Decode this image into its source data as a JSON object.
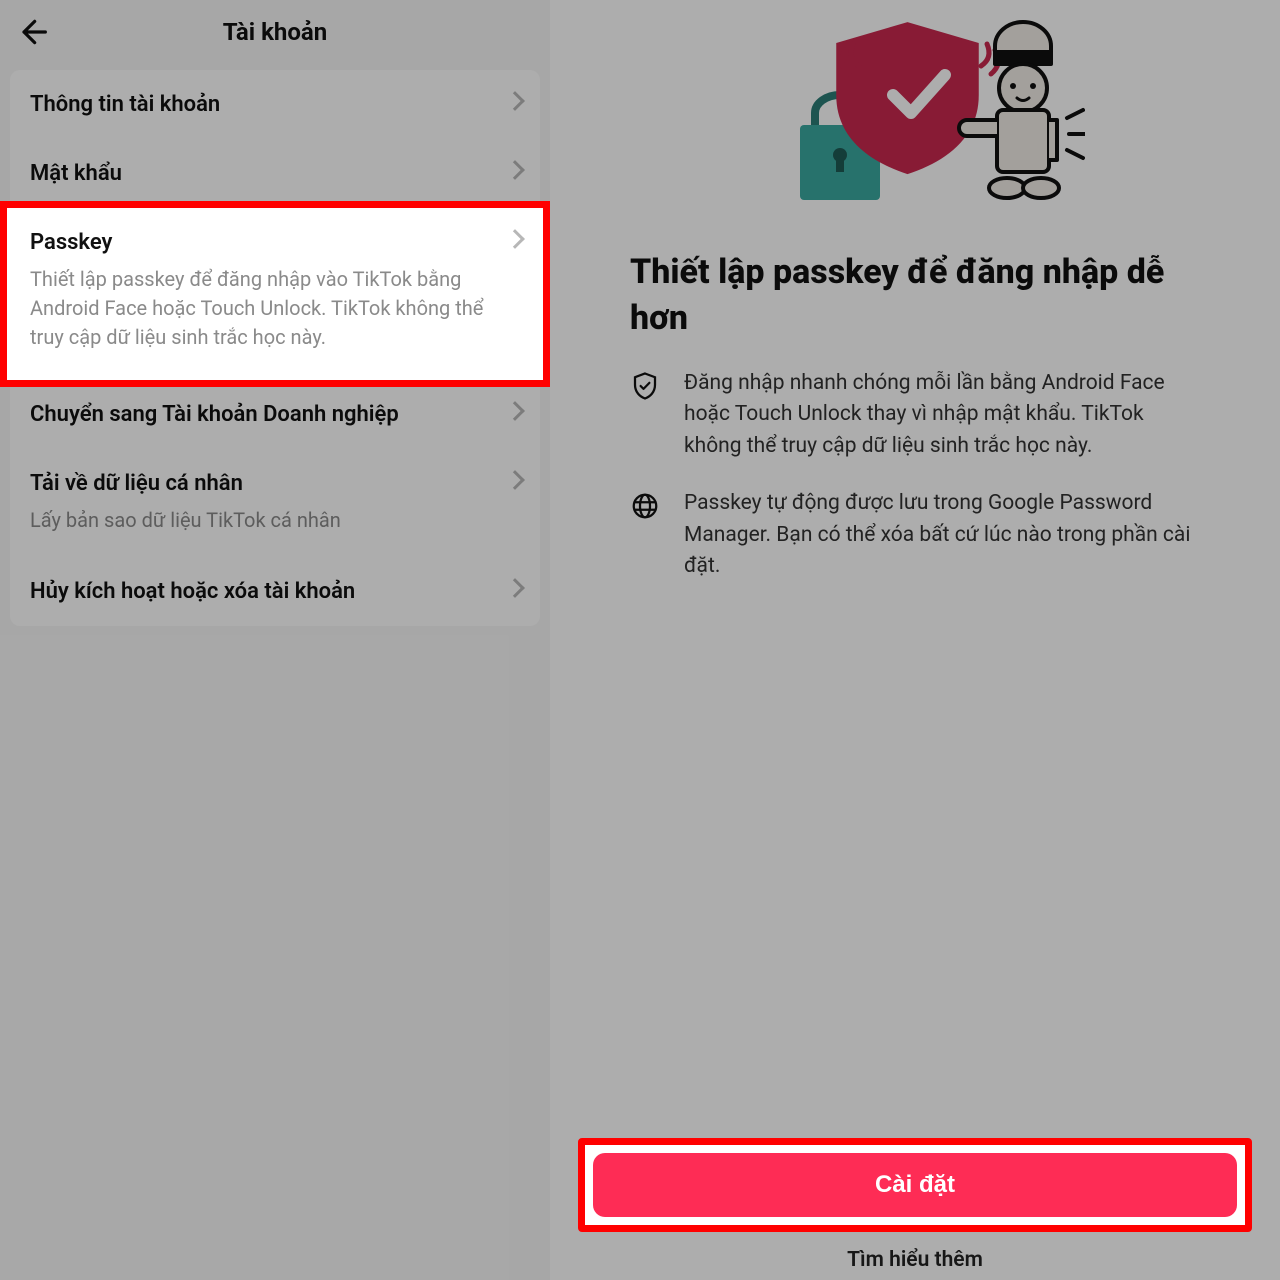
{
  "left": {
    "title": "Tài khoản",
    "rows": {
      "account_info": {
        "label": "Thông tin tài khoản"
      },
      "password": {
        "label": "Mật khẩu"
      },
      "passkey": {
        "label": "Passkey",
        "sub": "Thiết lập passkey để đăng nhập vào TikTok bằng Android Face hoặc Touch Unlock. TikTok không thể truy cập dữ liệu sinh trắc học này."
      },
      "business": {
        "label": "Chuyển sang Tài khoản Doanh nghiệp"
      },
      "download": {
        "label": "Tải về dữ liệu cá nhân",
        "sub": "Lấy bản sao dữ liệu TikTok cá nhân"
      },
      "deactivate": {
        "label": "Hủy kích hoạt hoặc xóa tài khoản"
      }
    }
  },
  "right": {
    "heading": "Thiết lập passkey để đăng nhập dễ hơn",
    "bullets": {
      "b1": "Đăng nhập nhanh chóng mỗi lần bằng Android Face hoặc Touch Unlock thay vì nhập mật khẩu. TikTok không thể truy cập dữ liệu sinh trắc học này.",
      "b2": "Passkey tự động được lưu trong Google Password Manager. Bạn có thể xóa bất cứ lúc nào trong phần cài đặt."
    },
    "primary": "Cài đặt",
    "learn_more": "Tìm hiểu thêm"
  },
  "colors": {
    "accent": "#fe2c55",
    "highlight_border": "#ff0000"
  }
}
